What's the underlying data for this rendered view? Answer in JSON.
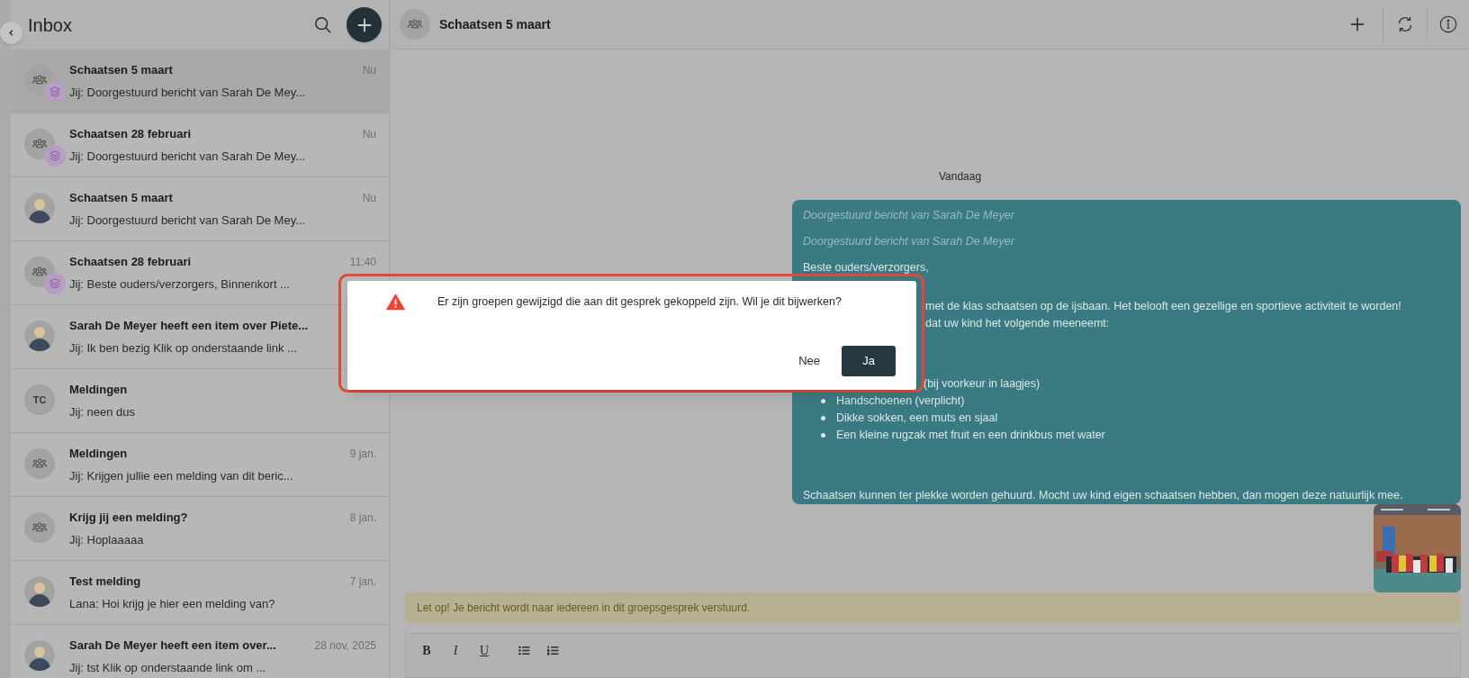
{
  "sidebar": {
    "title": "Inbox",
    "items": [
      {
        "title": "Schaatsen 5 maart",
        "preview": "Jij: Doorgestuurd bericht van Sarah De Mey...",
        "time": "Nu",
        "selected": true,
        "avatar": {
          "kind": "group",
          "badge": true
        }
      },
      {
        "title": "Schaatsen 28 februari",
        "preview": "Jij: Doorgestuurd bericht van Sarah De Mey...",
        "time": "Nu",
        "selected": false,
        "avatar": {
          "kind": "group",
          "badge": true
        }
      },
      {
        "title": "Schaatsen 5 maart",
        "preview": "Jij: Doorgestuurd bericht van Sarah De Mey...",
        "time": "Nu",
        "selected": false,
        "avatar": {
          "kind": "person"
        }
      },
      {
        "title": "Schaatsen 28 februari",
        "preview": "Jij:  Beste ouders/verzorgers, Binnenkort ...",
        "time": "11:40",
        "selected": false,
        "avatar": {
          "kind": "group",
          "badge": true
        }
      },
      {
        "title": "Sarah De Meyer heeft een item over Piete...",
        "preview": "Jij: Ik ben bezig Klik op onderstaande link ...",
        "selected": false,
        "avatar": {
          "kind": "person"
        }
      },
      {
        "title": "Meldingen",
        "preview": "Jij: neen dus",
        "selected": false,
        "avatar": {
          "kind": "initials",
          "text": "TC"
        }
      },
      {
        "title": "Meldingen",
        "preview": "Jij: Krijgen jullie een melding van dit beric...",
        "time": "9 jan.",
        "selected": false,
        "avatar": {
          "kind": "group"
        }
      },
      {
        "title": "Krijg jij een melding?",
        "preview": "Jij: Hoplaaaaa",
        "time": "8 jan.",
        "selected": false,
        "avatar": {
          "kind": "group"
        }
      },
      {
        "title": "Test melding",
        "preview": "Lana: Hoi krijg je hier een melding van?",
        "time": "7 jan.",
        "selected": false,
        "avatar": {
          "kind": "person"
        }
      },
      {
        "title": "Sarah De Meyer heeft een item over...",
        "preview": "Jij: tst Klik op onderstaande link om ...",
        "time": "28 nov. 2025",
        "selected": false,
        "avatar": {
          "kind": "person"
        }
      }
    ]
  },
  "conversation": {
    "title": "Schaatsen 5 maart",
    "date_divider": "Vandaag",
    "message": {
      "lines": [
        {
          "kind": "forward",
          "text": "Doorgestuurd bericht van Sarah De Meyer"
        },
        {
          "kind": "forward",
          "text": "Doorgestuurd bericht van Sarah De Meyer"
        },
        {
          "kind": "text",
          "text": "Beste ouders/verzorgers,"
        },
        {
          "kind": "gap"
        },
        {
          "kind": "text",
          "text": "met de klas schaatsen op de ijsbaan. Het belooft een gezellige en sportieve activiteit te worden!",
          "covered": true
        },
        {
          "kind": "text",
          "text": "dat uw kind het volgende meeneemt:",
          "covered": true
        },
        {
          "kind": "gap"
        },
        {
          "kind": "gap"
        },
        {
          "kind": "bullet",
          "text": "(bij voorkeur in laagjes)",
          "covered": true
        },
        {
          "kind": "bullet",
          "text": "Handschoenen (verplicht)"
        },
        {
          "kind": "bullet",
          "text": "Dikke sokken,  een muts en sjaal"
        },
        {
          "kind": "bullet",
          "text": "Een kleine rugzak met fruit en een drinkbus met water"
        },
        {
          "kind": "gap"
        },
        {
          "kind": "gap"
        },
        {
          "kind": "text",
          "text": "Schaatsen kunnen ter plekke worden gehuurd. Mocht uw kind eigen schaatsen hebben, dan mogen deze natuurlijk mee."
        }
      ]
    },
    "notice": "Let op! Je bericht wordt naar iedereen in dit groepsgesprek verstuurd.",
    "format_buttons": [
      {
        "label": "B",
        "kind": "bold"
      },
      {
        "label": "I",
        "kind": "italic"
      },
      {
        "label": "U",
        "kind": "underline"
      }
    ]
  },
  "dialog": {
    "message": "Er zijn groepen gewijzigd die aan dit gesprek gekoppeld zijn. Wil je dit bijwerken?",
    "buttons": [
      {
        "label": "Nee",
        "kind": "secondary"
      },
      {
        "label": "Ja",
        "kind": "primary"
      }
    ]
  }
}
